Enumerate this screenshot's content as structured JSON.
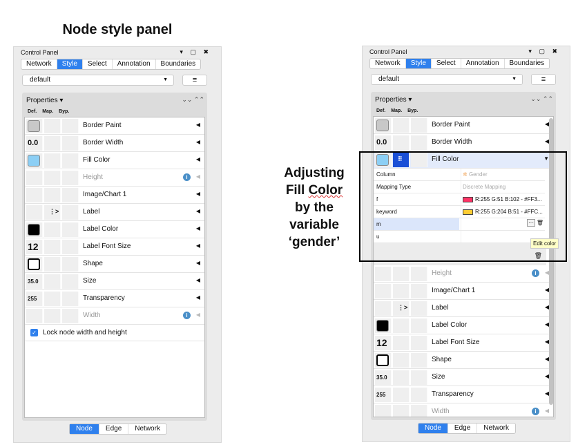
{
  "figure_title": "Node style panel",
  "annotation": {
    "line1": "Adjusting",
    "line2a": "Fill",
    "line2b": "Color",
    "line3": "by the",
    "line4": "variable",
    "line5": "‘gender’"
  },
  "panel": {
    "title": "Control Panel",
    "window_controls": "▾ ▢ ✖",
    "tabs": [
      "Network",
      "Style",
      "Select",
      "Annotation",
      "Boundaries"
    ],
    "active_tab": "Style",
    "style_dropdown": "default",
    "menu_icon": "≡",
    "properties_label": "Properties ▾",
    "collapse_icons": "⌄⌄ ⌃⌃",
    "columns": [
      "Def.",
      "Map.",
      "Byp."
    ],
    "rows": [
      {
        "label": "Border Paint",
        "def_type": "swatch",
        "def_color": "#c8c8c8"
      },
      {
        "label": "Border Width",
        "def_type": "text",
        "def_text": "0.0"
      },
      {
        "label": "Fill Color",
        "def_type": "swatch",
        "def_color": "#8ccff5"
      },
      {
        "label": "Height",
        "disabled": true,
        "info": true
      },
      {
        "label": "Image/Chart 1"
      },
      {
        "label": "Label",
        "mapped": "⋮>"
      },
      {
        "label": "Label Color",
        "def_type": "swatch",
        "def_color": "#000000"
      },
      {
        "label": "Label Font Size",
        "def_type": "text-lg",
        "def_text": "12"
      },
      {
        "label": "Shape",
        "def_type": "shape"
      },
      {
        "label": "Size",
        "def_type": "text-sm",
        "def_text": "35.0"
      },
      {
        "label": "Transparency",
        "def_type": "text-sm",
        "def_text": "255"
      },
      {
        "label": "Width",
        "disabled": true,
        "info": true
      }
    ],
    "lock_label": "Lock node width and height",
    "lock_checked": true,
    "bottom_tabs": [
      "Node",
      "Edge",
      "Network"
    ],
    "active_bottom_tab": "Node"
  },
  "mapping": {
    "column_label": "Column",
    "column_value": "Gender",
    "type_label": "Mapping Type",
    "type_value": "Discrete Mapping",
    "entries": [
      {
        "key": "f",
        "color": "#ff3366",
        "value": "R:255 G:51 B:102 - #FF3..."
      },
      {
        "key": "keyword",
        "color": "#ffcc33",
        "value": "R:255 G:204 B:51 - #FFC..."
      },
      {
        "key": "m",
        "value": "",
        "selected": true
      },
      {
        "key": "u",
        "value": ""
      }
    ],
    "edit_button": "···",
    "tooltip": "Edit color"
  },
  "colors": {
    "accent": "#2f80ed",
    "mapped_button": "#1a4fd6"
  }
}
